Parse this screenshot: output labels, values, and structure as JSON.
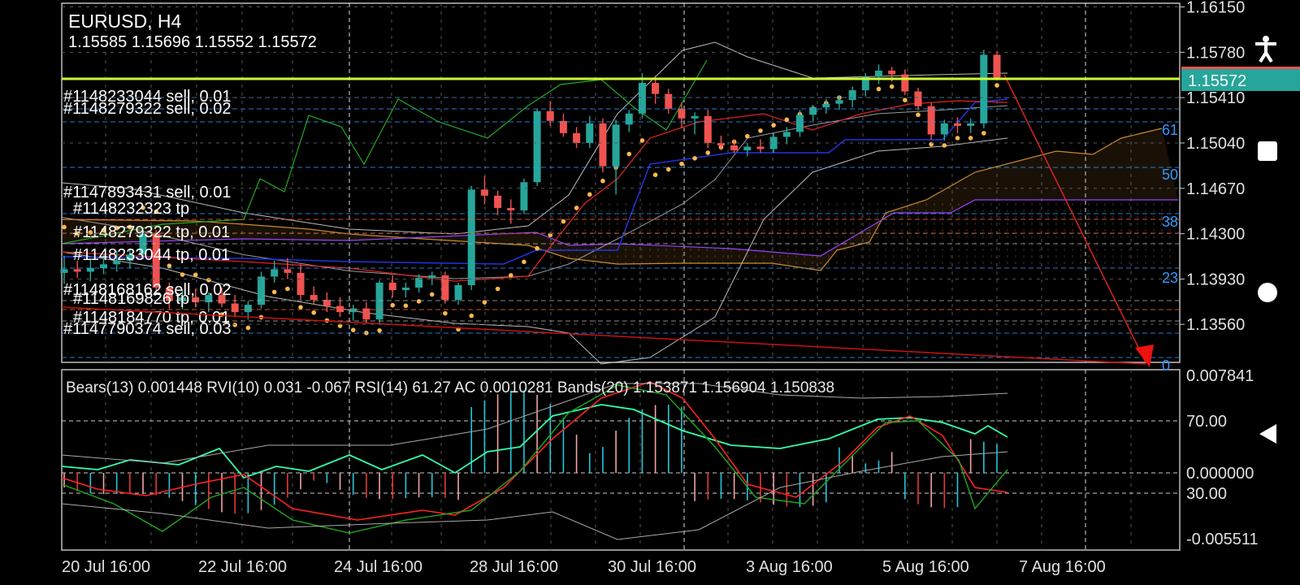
{
  "header": {
    "symbol": "EURUSD, H4",
    "ohlc": "1.15585 1.15696 1.15552 1.15572"
  },
  "indicators_line": "Bears(13) 0.001448 RVI(10) 0.031 -0.067 RSI(14) 61.27 AC 0.0010281 Bands(20) 1.153871 1.156904 1.150838",
  "current_price": "1.15572",
  "order_labels": [
    "#1148233044 sell, 0.01",
    "#1148279322 sell, 0.02",
    "#1147893431 sell, 0.01",
    "#1148232323 tp",
    "#1148279322 tp, 0.01",
    "#1148233044 tp, 0.01",
    "#1148168162 sell, 0.02",
    "#1148169826 tp",
    "#1148184770 tp, 0.01",
    "#1147790374 sell, 0.03"
  ],
  "fib_levels": [
    "61",
    "50",
    "38",
    "23",
    "0"
  ],
  "colors": {
    "bull": "#26a69a",
    "bear": "#ef5350",
    "price_line": "#ccff33",
    "price_badge": "#26a69a",
    "sar": "#ffb84d",
    "cloud": "#cc8a2e",
    "fib": "#3399ff",
    "grid": "#555555"
  },
  "chart_data": {
    "type": "candlestick",
    "symbol": "EURUSD",
    "timeframe": "H4",
    "price_axis": {
      "ylim": [
        1.1325,
        1.1618
      ],
      "ticks": [
        "1.16150",
        "1.15780",
        "1.15410",
        "1.15040",
        "1.14670",
        "1.14300",
        "1.13930",
        "1.13560"
      ]
    },
    "x_ticks": [
      "20 Jul 16:00",
      "22 Jul 16:00",
      "24 Jul 16:00",
      "28 Jul 16:00",
      "30 Jul 16:00",
      "3 Aug 16:00",
      "5 Aug 16:00",
      "7 Aug 16:00"
    ],
    "candles_ohlc": [
      [
        1.1398,
        1.1412,
        1.1389,
        1.1401
      ],
      [
        1.1401,
        1.1408,
        1.1394,
        1.1399
      ],
      [
        1.1399,
        1.141,
        1.1391,
        1.1402
      ],
      [
        1.1402,
        1.1413,
        1.1397,
        1.1405
      ],
      [
        1.1405,
        1.1416,
        1.1399,
        1.1408
      ],
      [
        1.1408,
        1.1418,
        1.1402,
        1.1413
      ],
      [
        1.1413,
        1.1435,
        1.1409,
        1.143
      ],
      [
        1.143,
        1.1433,
        1.138,
        1.1386
      ],
      [
        1.1386,
        1.139,
        1.1369,
        1.1375
      ],
      [
        1.1375,
        1.1384,
        1.1368,
        1.1378
      ],
      [
        1.1378,
        1.1385,
        1.137,
        1.1374
      ],
      [
        1.1374,
        1.1382,
        1.1366,
        1.138
      ],
      [
        1.138,
        1.1386,
        1.137,
        1.1373
      ],
      [
        1.1373,
        1.138,
        1.1362,
        1.1366
      ],
      [
        1.1366,
        1.1375,
        1.136,
        1.1372
      ],
      [
        1.1372,
        1.1399,
        1.1369,
        1.1395
      ],
      [
        1.1395,
        1.1408,
        1.139,
        1.1401
      ],
      [
        1.1401,
        1.141,
        1.1393,
        1.1398
      ],
      [
        1.1398,
        1.1405,
        1.1376,
        1.138
      ],
      [
        1.138,
        1.1387,
        1.1372,
        1.1376
      ],
      [
        1.1376,
        1.1382,
        1.1366,
        1.1371
      ],
      [
        1.1371,
        1.1378,
        1.1362,
        1.1366
      ],
      [
        1.1366,
        1.1372,
        1.1359,
        1.1369
      ],
      [
        1.1369,
        1.1374,
        1.1357,
        1.136
      ],
      [
        1.136,
        1.1392,
        1.1357,
        1.139
      ],
      [
        1.139,
        1.1396,
        1.1378,
        1.1384
      ],
      [
        1.1384,
        1.139,
        1.1378,
        1.1386
      ],
      [
        1.1386,
        1.1397,
        1.1382,
        1.1394
      ],
      [
        1.1394,
        1.1399,
        1.1388,
        1.1396
      ],
      [
        1.1396,
        1.1399,
        1.1373,
        1.1376
      ],
      [
        1.1376,
        1.139,
        1.1372,
        1.1388
      ],
      [
        1.1388,
        1.1469,
        1.1384,
        1.1466
      ],
      [
        1.1466,
        1.1477,
        1.1454,
        1.1461
      ],
      [
        1.1461,
        1.1465,
        1.1445,
        1.1451
      ],
      [
        1.1451,
        1.1458,
        1.1438,
        1.1449
      ],
      [
        1.1449,
        1.1475,
        1.1446,
        1.1472
      ],
      [
        1.1472,
        1.1532,
        1.1469,
        1.153
      ],
      [
        1.153,
        1.1538,
        1.1518,
        1.1522
      ],
      [
        1.1522,
        1.1528,
        1.1509,
        1.1512
      ],
      [
        1.1512,
        1.1517,
        1.15,
        1.1504
      ],
      [
        1.1504,
        1.1526,
        1.15,
        1.152
      ],
      [
        1.152,
        1.1524,
        1.148,
        1.1485
      ],
      [
        1.1485,
        1.1523,
        1.1462,
        1.1519
      ],
      [
        1.1519,
        1.1531,
        1.1513,
        1.1528
      ],
      [
        1.1528,
        1.1561,
        1.1524,
        1.1553
      ],
      [
        1.1553,
        1.1559,
        1.1536,
        1.1544
      ],
      [
        1.1544,
        1.1548,
        1.1528,
        1.1532
      ],
      [
        1.1532,
        1.1537,
        1.1516,
        1.1524
      ],
      [
        1.1524,
        1.1529,
        1.1511,
        1.1526
      ],
      [
        1.1526,
        1.1531,
        1.15,
        1.1504
      ],
      [
        1.1504,
        1.151,
        1.1498,
        1.1502
      ],
      [
        1.1502,
        1.1507,
        1.1496,
        1.1498
      ],
      [
        1.1498,
        1.1504,
        1.1493,
        1.1501
      ],
      [
        1.1501,
        1.1507,
        1.1496,
        1.1499
      ],
      [
        1.1499,
        1.1512,
        1.1496,
        1.1509
      ],
      [
        1.1509,
        1.1517,
        1.1503,
        1.1513
      ],
      [
        1.1513,
        1.1531,
        1.1509,
        1.1527
      ],
      [
        1.1527,
        1.1535,
        1.1522,
        1.1533
      ],
      [
        1.1533,
        1.154,
        1.1528,
        1.1536
      ],
      [
        1.1536,
        1.1543,
        1.1531,
        1.1539
      ],
      [
        1.1539,
        1.155,
        1.1533,
        1.1547
      ],
      [
        1.1547,
        1.1561,
        1.1542,
        1.1558
      ],
      [
        1.1558,
        1.1568,
        1.1552,
        1.1563
      ],
      [
        1.1563,
        1.1566,
        1.1554,
        1.156
      ],
      [
        1.156,
        1.1564,
        1.1543,
        1.1546
      ],
      [
        1.1546,
        1.1549,
        1.1531,
        1.1534
      ],
      [
        1.1534,
        1.1537,
        1.1507,
        1.1511
      ],
      [
        1.1511,
        1.1523,
        1.1506,
        1.152
      ],
      [
        1.152,
        1.1525,
        1.1512,
        1.1518
      ],
      [
        1.1518,
        1.1524,
        1.1512,
        1.152
      ],
      [
        1.152,
        1.158,
        1.1516,
        1.1576
      ],
      [
        1.1576,
        1.1579,
        1.1555,
        1.1557
      ]
    ],
    "oscillator_axis": {
      "ticks": [
        "0.007841",
        "70.00",
        "0.000000",
        "30.00",
        "-0.005511"
      ]
    },
    "oscillator_series": [
      {
        "name": "RSI(14)",
        "last": 61.27
      },
      {
        "name": "RVI(10)",
        "values": [
          0.031,
          -0.067
        ]
      },
      {
        "name": "Bears(13)",
        "last": 0.001448
      },
      {
        "name": "AC",
        "last": 0.0010281
      },
      {
        "name": "Bands(20)",
        "values": [
          1.153871,
          1.156904,
          1.150838
        ]
      }
    ],
    "grid": true
  }
}
